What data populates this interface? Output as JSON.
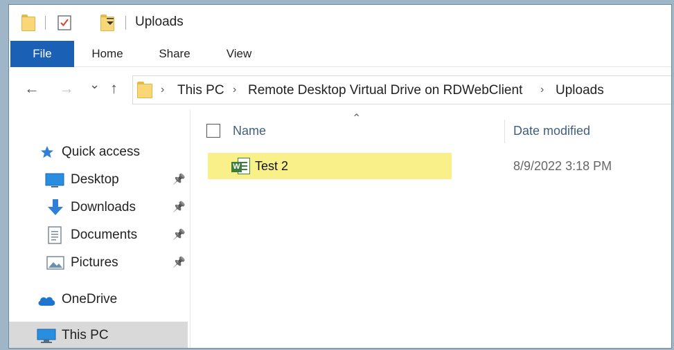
{
  "window": {
    "title": "Uploads"
  },
  "quick_access": {
    "icons": [
      "folder-icon",
      "properties-icon",
      "new-folder-icon",
      "customize-dropdown-icon"
    ],
    "customize_glyph": "⯆"
  },
  "ribbon": {
    "tabs": [
      {
        "label": "File",
        "active": true
      },
      {
        "label": "Home"
      },
      {
        "label": "Share"
      },
      {
        "label": "View"
      }
    ],
    "file_color": "#1a61b5"
  },
  "nav": {
    "back": "←",
    "forward": "→",
    "recent": "⌄",
    "up": "↑"
  },
  "address": {
    "crumbs": [
      "This PC",
      "Remote Desktop Virtual Drive on RDWebClient",
      "Uploads"
    ],
    "separator": "›"
  },
  "sidebar": {
    "items": [
      {
        "label": "Quick access",
        "icon": "star-icon"
      },
      {
        "label": "Desktop",
        "icon": "desktop-icon",
        "pinned": true
      },
      {
        "label": "Downloads",
        "icon": "download-arrow-icon",
        "pinned": true
      },
      {
        "label": "Documents",
        "icon": "documents-icon",
        "pinned": true
      },
      {
        "label": "Pictures",
        "icon": "pictures-icon",
        "pinned": true
      },
      {
        "label": "OneDrive",
        "icon": "cloud-icon"
      },
      {
        "label": "This PC",
        "icon": "computer-icon",
        "selected": true
      }
    ],
    "pin_glyph": "📌"
  },
  "content": {
    "sort_glyph": "⌃",
    "columns": {
      "name": "Name",
      "date_modified": "Date modified"
    },
    "files": [
      {
        "name": "Test 2",
        "date_modified": "8/9/2022 3:18 PM",
        "icon": "word-document-icon",
        "highlight": "#faf08a"
      }
    ]
  }
}
